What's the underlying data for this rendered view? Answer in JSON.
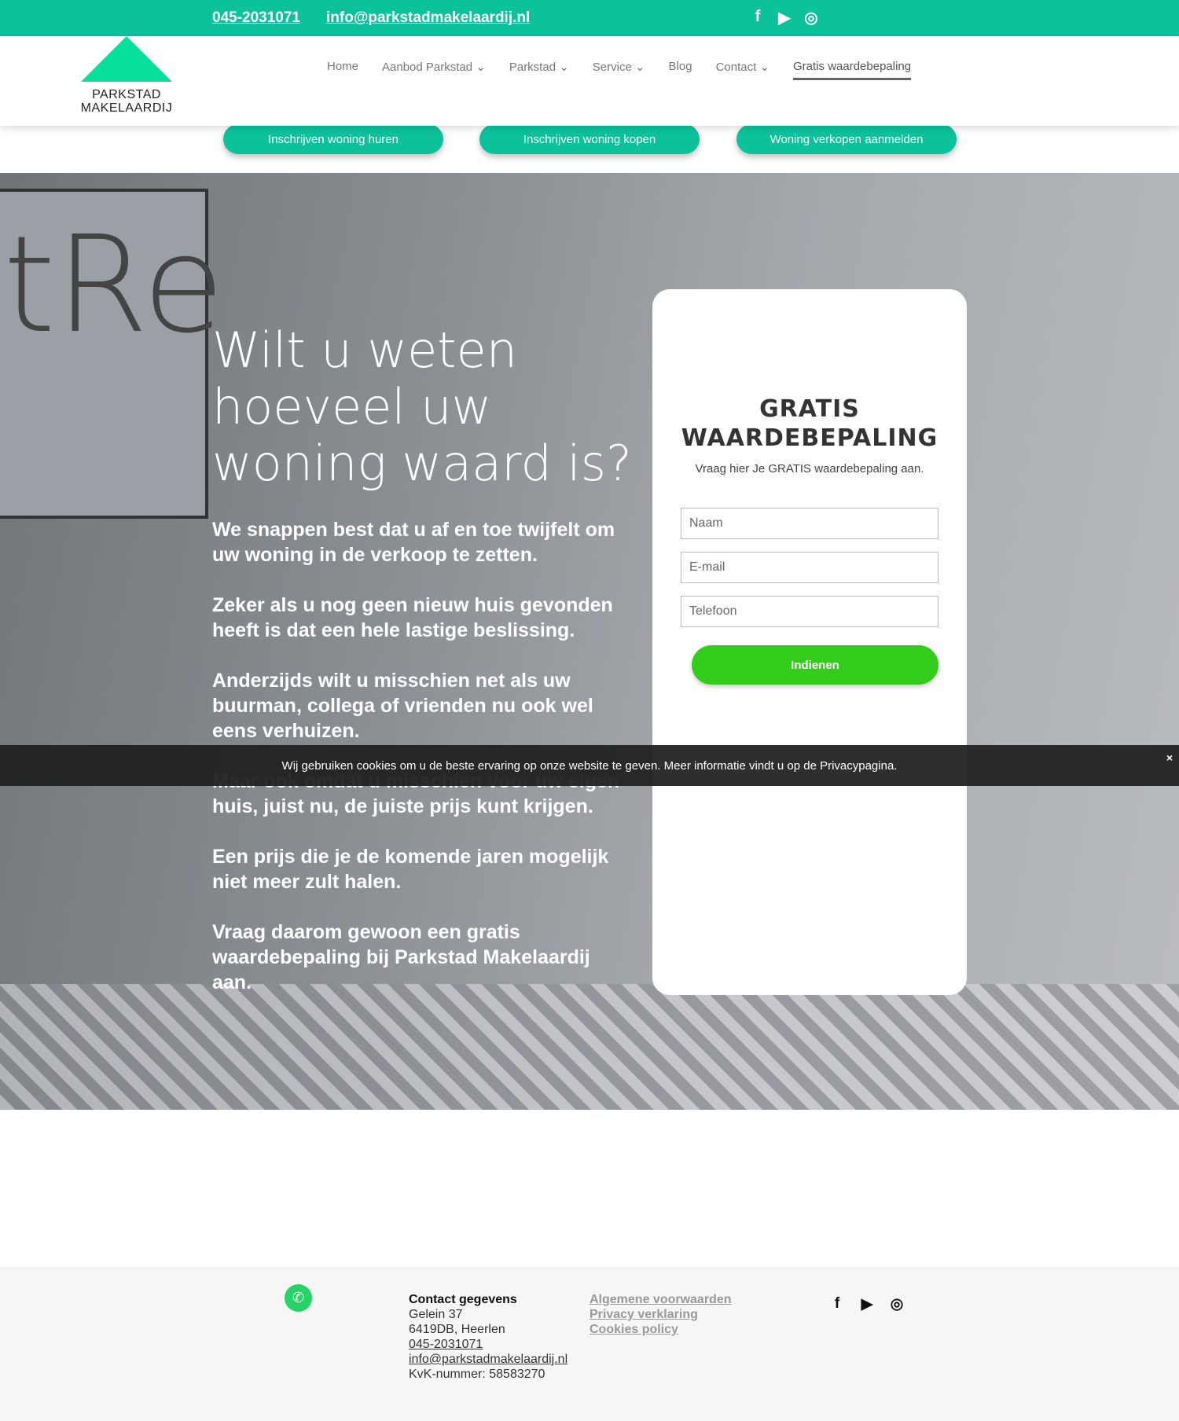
{
  "topbar": {
    "phone": "045-2031071",
    "email": "info@parkstadmakelaardij.nl",
    "icons": [
      "facebook-icon",
      "youtube-icon",
      "instagram-icon"
    ]
  },
  "logo": {
    "line1": "PARKSTAD",
    "line2": "MAKELAARDIJ"
  },
  "nav": [
    {
      "label": "Home"
    },
    {
      "label": "Aanbod Parkstad ⌄"
    },
    {
      "label": "Parkstad ⌄"
    },
    {
      "label": "Service ⌄"
    },
    {
      "label": "Blog"
    },
    {
      "label": "Contact ⌄"
    },
    {
      "label": "Gratis waardebepaling",
      "active": true
    }
  ],
  "cta": [
    "Inschrijven woning huren",
    "Inschrijven woning kopen",
    "Woning verkopen aanmelden"
  ],
  "hero": {
    "title": "Wilt u weten hoeveel uw woning waard is?",
    "paragraphs": [
      "We snappen best dat u af en toe twijfelt om uw woning in de verkoop te zetten.",
      "Zeker als u nog geen nieuw huis gevonden heeft is dat een hele lastige beslissing.",
      "Anderzijds wilt u misschien net als uw buurman, collega of vrienden nu ook wel eens verhuizen.",
      "Maar ook omdat u misschien voor uw eigen huis, juist nu, de juiste prijs kunt krijgen.",
      "Een prijs die je de komende jaren mogelijk niet meer zult halen.",
      "Vraag daarom gewoon een gratis waardebepaling bij Parkstad Makelaardij aan."
    ]
  },
  "form": {
    "title": "GRATIS WAARDEBEPALING",
    "subtitle": "Vraag hier Je GRATIS waardebepaling aan.",
    "name_placeholder": "Naam",
    "email_placeholder": "E-mail",
    "phone_placeholder": "Telefoon",
    "submit": "Indienen"
  },
  "cookie": {
    "text": "Wij gebruiken cookies om u de beste ervaring op onze website te geven. Meer informatie vindt u op de Privacypagina.",
    "close": "×"
  },
  "footer": {
    "contact_title": "Contact gegevens",
    "street": "Gelein 37",
    "city": "6419DB, Heerlen",
    "phone": "045-2031071",
    "email": "info@parkstadmakelaardij.nl",
    "kvk": "KvK-nummer: 58583270",
    "links": [
      "Algemene voorwaarden",
      "Privacy verklaring",
      "Cookies policy"
    ]
  },
  "colors": {
    "brand": "#0bc29d",
    "submit": "#33cc1a"
  }
}
